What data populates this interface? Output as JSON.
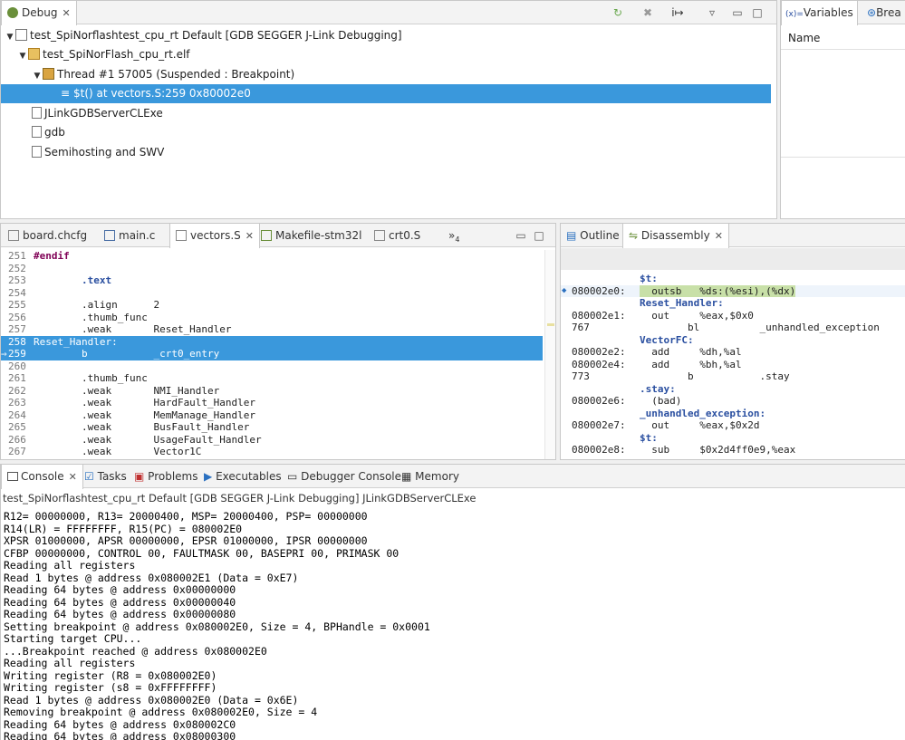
{
  "debug": {
    "tab_label": "Debug",
    "tree": [
      {
        "label": "test_SpiNorflashtest_cpu_rt Default [GDB SEGGER J-Link Debugging]"
      },
      {
        "label": "test_SpiNorFlash_cpu_rt.elf"
      },
      {
        "label": "Thread #1 57005 (Suspended : Breakpoint)"
      },
      {
        "label": "$t() at vectors.S:259 0x80002e0"
      },
      {
        "label": "JLinkGDBServerCLExe"
      },
      {
        "label": "gdb"
      },
      {
        "label": "Semihosting and SWV"
      }
    ]
  },
  "variables": {
    "tab_label": "Variables",
    "tab2_label": "Brea",
    "column_name": "Name"
  },
  "editor": {
    "tabs": [
      "board.chcfg",
      "main.c",
      "vectors.S",
      "Makefile-stm32l",
      "crt0.S"
    ],
    "overflow_count": "4",
    "lines": [
      {
        "n": "251",
        "t": "#endif"
      },
      {
        "n": "252",
        "t": ""
      },
      {
        "n": "253",
        "t": "        .text"
      },
      {
        "n": "254",
        "t": ""
      },
      {
        "n": "255",
        "t": "        .align      2"
      },
      {
        "n": "256",
        "t": "        .thumb_func"
      },
      {
        "n": "257",
        "t": "        .weak       Reset_Handler"
      },
      {
        "n": "258",
        "t": "Reset_Handler:"
      },
      {
        "n": "259",
        "t": "        b           _crt0_entry"
      },
      {
        "n": "260",
        "t": ""
      },
      {
        "n": "261",
        "t": "        .thumb_func"
      },
      {
        "n": "262",
        "t": "        .weak       NMI_Handler"
      },
      {
        "n": "263",
        "t": "        .weak       HardFault_Handler"
      },
      {
        "n": "264",
        "t": "        .weak       MemManage_Handler"
      },
      {
        "n": "265",
        "t": "        .weak       BusFault_Handler"
      },
      {
        "n": "266",
        "t": "        .weak       UsageFault_Handler"
      },
      {
        "n": "267",
        "t": "        .weak       Vector1C"
      }
    ]
  },
  "disasm": {
    "tab_outline": "Outline",
    "tab_disasm": "Disassembly",
    "lines": [
      {
        "a": "",
        "t": "$t:"
      },
      {
        "a": "080002e0:",
        "t": "  outsb   %ds:(%esi),(%dx)"
      },
      {
        "a": "",
        "t": "Reset_Handler:"
      },
      {
        "a": "080002e1:",
        "t": "  out     %eax,$0x0"
      },
      {
        "a": "767",
        "t": "        bl          _unhandled_exception"
      },
      {
        "a": "",
        "t": "VectorFC:"
      },
      {
        "a": "080002e2:",
        "t": "  add     %dh,%al"
      },
      {
        "a": "080002e4:",
        "t": "  add     %bh,%al"
      },
      {
        "a": "773",
        "t": "        b           .stay"
      },
      {
        "a": "",
        "t": ".stay:"
      },
      {
        "a": "080002e6:",
        "t": "  (bad)"
      },
      {
        "a": "",
        "t": "_unhandled_exception:"
      },
      {
        "a": "080002e7:",
        "t": "  out     %eax,$0x2d"
      },
      {
        "a": "",
        "t": "$t:"
      },
      {
        "a": "080002e8:",
        "t": "  sub     $0x2d4ff0e9,%eax"
      }
    ]
  },
  "console": {
    "tabs": [
      "Console",
      "Tasks",
      "Problems",
      "Executables",
      "Debugger Console",
      "Memory"
    ],
    "title": "test_SpiNorflashtest_cpu_rt Default [GDB SEGGER J-Link Debugging] JLinkGDBServerCLExe",
    "lines": [
      "R12= 00000000, R13= 20000400, MSP= 20000400, PSP= 00000000",
      "R14(LR) = FFFFFFFF, R15(PC) = 080002E0",
      "XPSR 01000000, APSR 00000000, EPSR 01000000, IPSR 00000000",
      "CFBP 00000000, CONTROL 00, FAULTMASK 00, BASEPRI 00, PRIMASK 00",
      "Reading all registers",
      "Read 1 bytes @ address 0x080002E1 (Data = 0xE7)",
      "Reading 64 bytes @ address 0x00000000",
      "Reading 64 bytes @ address 0x00000040",
      "Reading 64 bytes @ address 0x00000080",
      "Setting breakpoint @ address 0x080002E0, Size = 4, BPHandle = 0x0001",
      "Starting target CPU...",
      "...Breakpoint reached @ address 0x080002E0",
      "Reading all registers",
      "Writing register (R8 = 0x080002E0)",
      "Writing register (s8 = 0xFFFFFFFF)",
      "Read 1 bytes @ address 0x080002E0 (Data = 0x6E)",
      "Removing breakpoint @ address 0x080002E0, Size = 4",
      "Reading 64 bytes @ address 0x080002C0",
      "Reading 64 bytes @ address 0x08000300"
    ]
  },
  "colors": {
    "selection": "#3a98dc",
    "keyword": "#7f0055",
    "directive": "#2a4fa0"
  }
}
